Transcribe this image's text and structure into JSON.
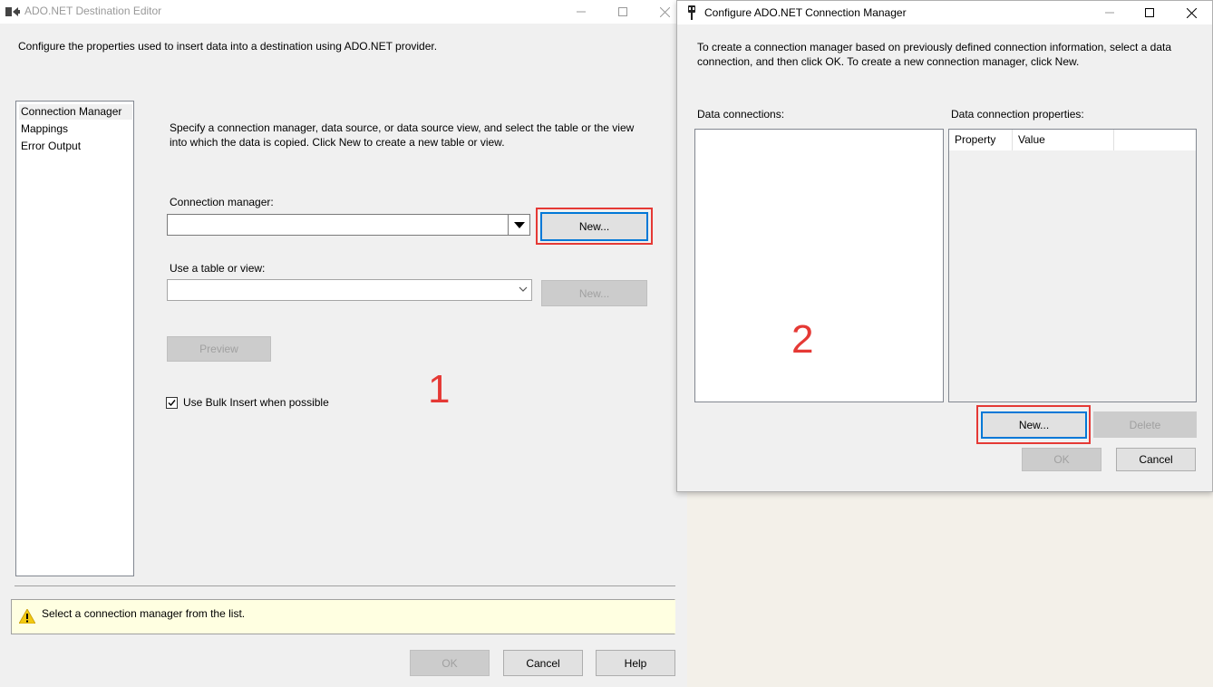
{
  "window1": {
    "title": "ADO.NET Destination Editor",
    "description": "Configure the properties used to insert data into a destination using ADO.NET provider.",
    "nav_items": [
      "Connection Manager",
      "Mappings",
      "Error Output"
    ],
    "instructions": "Specify a connection manager, data source, or data source view, and select the table or the view into which the data is copied. Click New to create a new table or view.",
    "connection_manager_label": "Connection manager:",
    "connection_manager_value": "",
    "new_connection_button": "New...",
    "table_label": "Use a table or view:",
    "table_value": "",
    "new_table_button": "New...",
    "preview_button": "Preview",
    "bulk_insert_label": "Use Bulk Insert when possible",
    "bulk_insert_checked": true,
    "status_message": "Select a connection manager from the list.",
    "ok_button": "OK",
    "cancel_button": "Cancel",
    "help_button": "Help",
    "step_marker": "1"
  },
  "window2": {
    "title": "Configure ADO.NET Connection Manager",
    "description": "To create a connection manager based on previously defined connection information, select a data connection, and then click OK. To create a new connection manager, click New.",
    "data_connections_label": "Data connections:",
    "properties_label": "Data connection properties:",
    "grid_columns": [
      "Property",
      "Value"
    ],
    "new_button": "New...",
    "delete_button": "Delete",
    "ok_button": "OK",
    "cancel_button": "Cancel",
    "step_marker": "2"
  },
  "colors": {
    "highlight": "#e53935",
    "focus": "#0078d7",
    "status_background": "#ffffe1"
  }
}
